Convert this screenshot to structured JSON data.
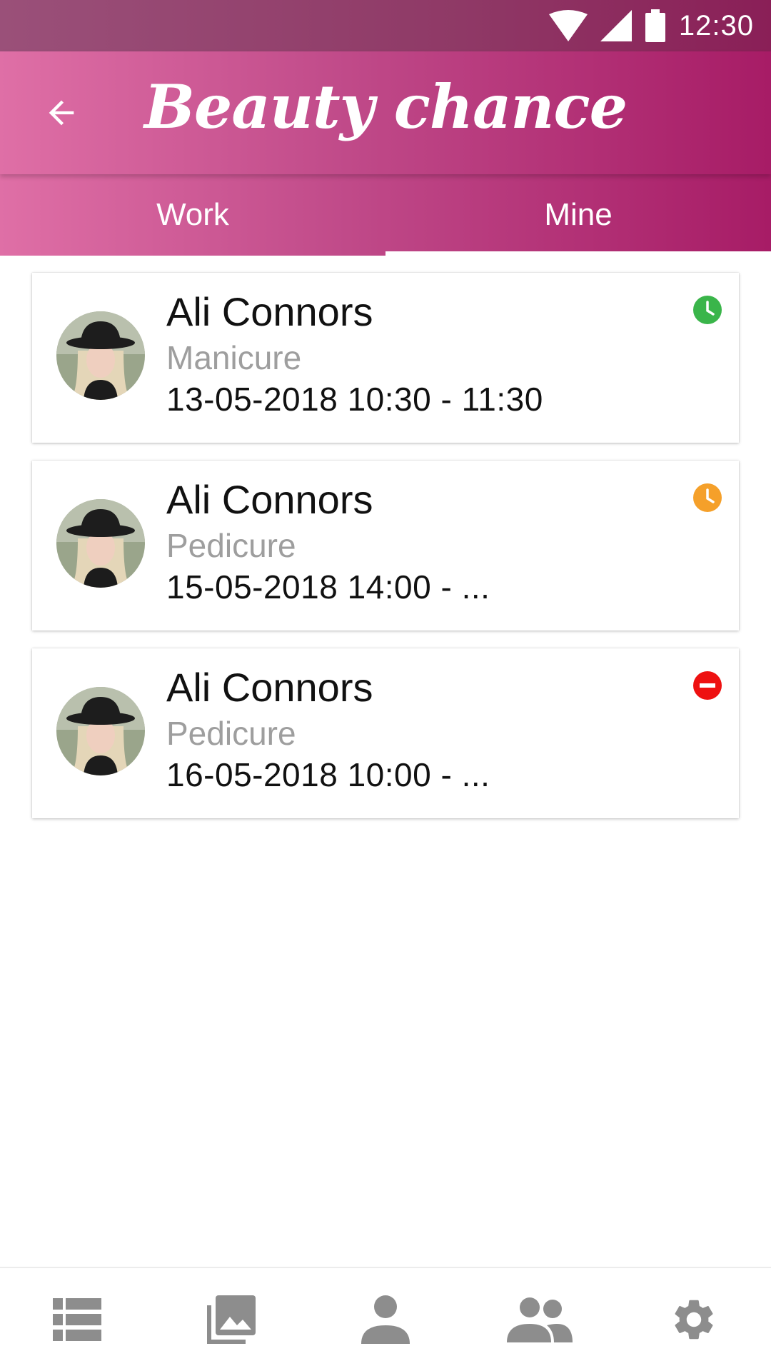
{
  "status_bar": {
    "time": "12:30"
  },
  "app_bar": {
    "title": "Beauty chance"
  },
  "tabs": [
    {
      "label": "Work",
      "active": false
    },
    {
      "label": "Mine",
      "active": true
    }
  ],
  "appointments": [
    {
      "name": "Ali Connors",
      "service": "Manicure",
      "datetime": "13-05-2018 10:30 - 11:30",
      "status_icon": "clock-icon",
      "status_color": "#3ab54a"
    },
    {
      "name": "Ali Connors",
      "service": "Pedicure",
      "datetime": "15-05-2018 14:00 - ...",
      "status_icon": "clock-icon",
      "status_color": "#f5a02a"
    },
    {
      "name": "Ali Connors",
      "service": "Pedicure",
      "datetime": "16-05-2018 10:00 - ...",
      "status_icon": "minus-circle-icon",
      "status_color": "#ee1111"
    }
  ],
  "bottom_nav": [
    "list-icon",
    "gallery-icon",
    "person-icon",
    "group-icon",
    "settings-icon"
  ],
  "colors": {
    "accent_start": "#df6fa6",
    "accent_end": "#a71c66",
    "nav_icon": "#8d8d8d"
  }
}
